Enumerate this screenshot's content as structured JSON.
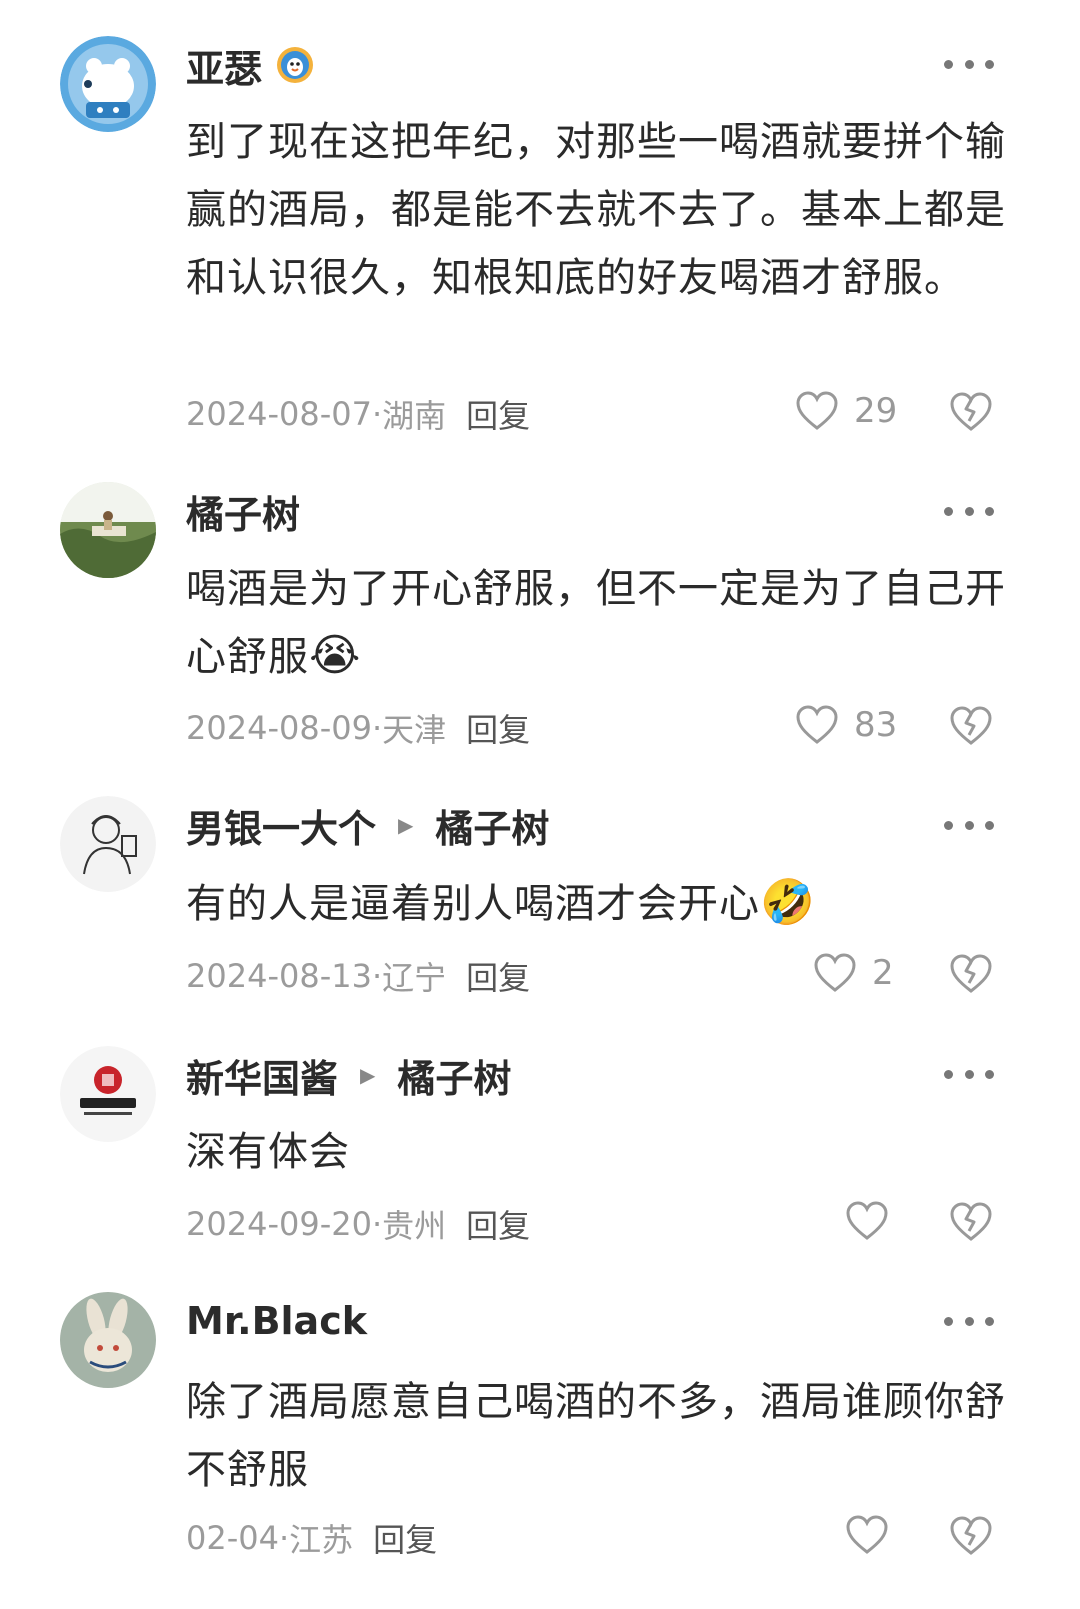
{
  "comments": [
    {
      "username": "亚瑟",
      "reply_to": "",
      "text": "到了现在这把年纪，对那些一喝酒就要拼个输赢的酒局，都是能不去就不去了。基本上都是和认识很久，知根知底的好友喝酒才舒服。",
      "emoji": "",
      "date": "2024-08-07",
      "location": "湖南",
      "reply_label": "回复",
      "likes": "29",
      "avatar_icon": "polar-bear-avatar",
      "has_badge": true
    },
    {
      "username": "橘子树",
      "reply_to": "",
      "text": "喝酒是为了开心舒服，但不一定是为了自己开心舒服",
      "emoji": "😭",
      "date": "2024-08-09",
      "location": "天津",
      "reply_label": "回复",
      "likes": "83",
      "avatar_icon": "field-photo-avatar"
    },
    {
      "username": "男银一大个",
      "reply_to": "橘子树",
      "text": "有的人是逼着别人喝酒才会开心",
      "emoji": "🤣",
      "date": "2024-08-13",
      "location": "辽宁",
      "reply_label": "回复",
      "likes": "2",
      "avatar_icon": "sketch-avatar"
    },
    {
      "username": "新华国酱",
      "reply_to": "橘子树",
      "text": "深有体会",
      "emoji": "",
      "date": "2024-09-20",
      "location": "贵州",
      "reply_label": "回复",
      "likes": "",
      "avatar_icon": "brand-logo-avatar"
    },
    {
      "username": "Mr.Black",
      "reply_to": "",
      "text": "除了酒局愿意自己喝酒的不多，酒局谁顾你舒不舒服",
      "emoji": "",
      "date": "02-04",
      "location": "江苏",
      "reply_label": "回复",
      "likes": "",
      "avatar_icon": "rabbit-art-avatar"
    }
  ],
  "meta_separator": " · ",
  "colors": {
    "text": "#2a2a2a",
    "meta": "#9b9b9b",
    "icon": "#999999"
  }
}
